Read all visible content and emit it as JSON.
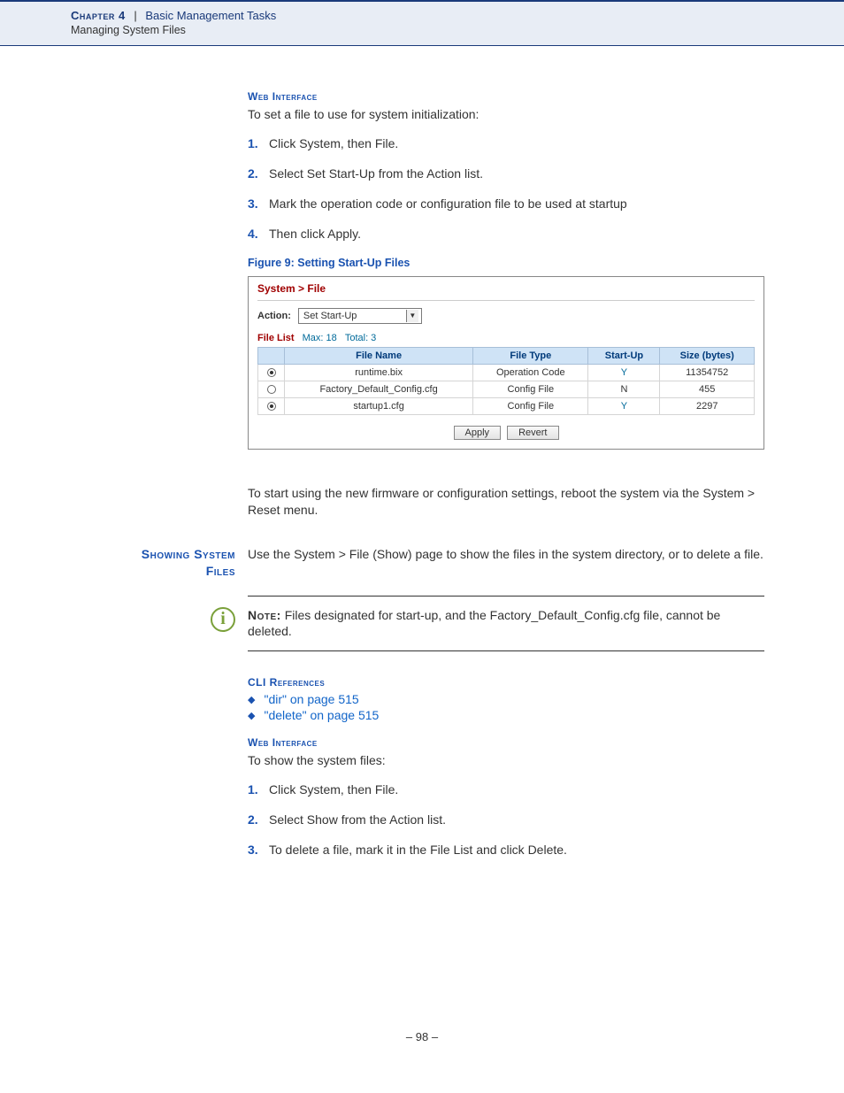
{
  "header": {
    "chapter_label": "Chapter 4",
    "separator": "|",
    "chapter_topic": "Basic Management Tasks",
    "section": "Managing System Files"
  },
  "sec1": {
    "heading": "Web Interface",
    "intro": "To set a file to use for system initialization:",
    "steps": [
      "Click System, then File.",
      "Select Set Start-Up from the Action list.",
      "Mark the operation code or configuration file to be used at startup",
      "Then click Apply."
    ],
    "figure_caption": "Figure 9:  Setting Start-Up Files"
  },
  "ui": {
    "breadcrumb": "System > File",
    "action_label": "Action:",
    "action_value": "Set Start-Up",
    "list_label": "File List",
    "list_max_label": "Max: 18",
    "list_total_label": "Total: 3",
    "columns": [
      "",
      "File Name",
      "File Type",
      "Start-Up",
      "Size (bytes)"
    ],
    "rows": [
      {
        "selected": true,
        "name": "runtime.bix",
        "type": "Operation Code",
        "startup": "Y",
        "size": "11354752"
      },
      {
        "selected": false,
        "name": "Factory_Default_Config.cfg",
        "type": "Config File",
        "startup": "N",
        "size": "455"
      },
      {
        "selected": true,
        "name": "startup1.cfg",
        "type": "Config File",
        "startup": "Y",
        "size": "2297"
      }
    ],
    "buttons": {
      "apply": "Apply",
      "revert": "Revert"
    }
  },
  "after_figure": "To start using the new firmware or configuration settings, reboot the system via the System > Reset menu.",
  "sec2": {
    "side_heading_line1": "Showing System",
    "side_heading_line2": "Files",
    "intro": "Use the System > File (Show) page to show the files in the system directory, or to delete a file.",
    "note_label": "Note:",
    "note_text": " Files designated for start-up, and the Factory_Default_Config.cfg file, cannot be deleted.",
    "cli_heading": "CLI References",
    "cli_links": [
      "\"dir\" on page 515",
      "\"delete\" on page 515"
    ],
    "web_heading": "Web Interface",
    "web_intro": "To show the system files:",
    "steps": [
      "Click System, then File.",
      "Select Show from the Action list.",
      "To delete a file, mark it in the File List and click Delete."
    ]
  },
  "page_number": "–  98  –"
}
